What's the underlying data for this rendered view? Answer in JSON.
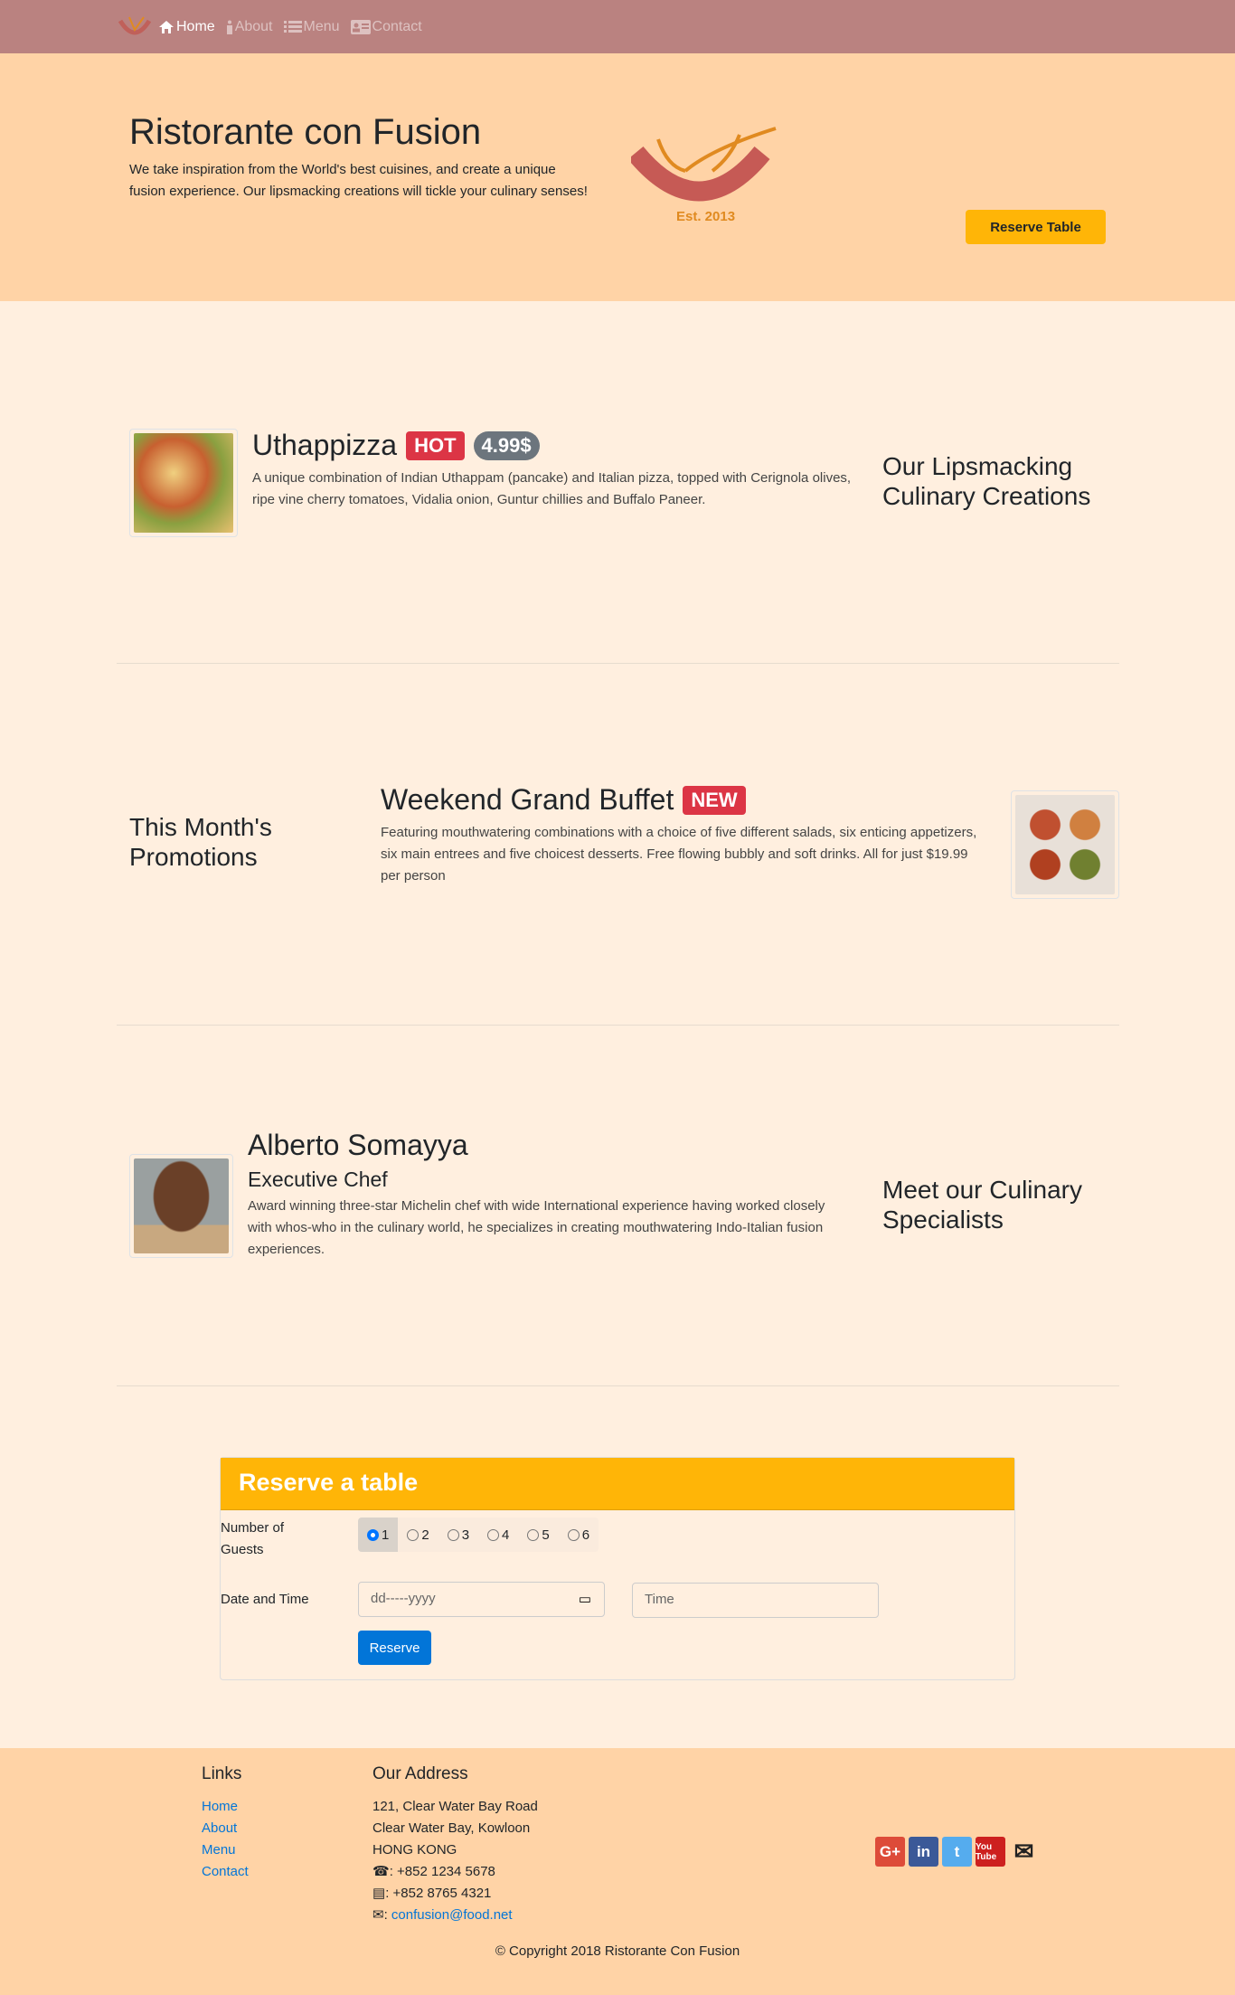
{
  "nav": {
    "items": [
      {
        "label": "Home",
        "icon": "home-icon",
        "active": true
      },
      {
        "label": "About",
        "icon": "info-icon"
      },
      {
        "label": "Menu",
        "icon": "list-icon"
      },
      {
        "label": "Contact",
        "icon": "address-card-icon"
      }
    ]
  },
  "hero": {
    "title": "Ristorante con Fusion",
    "text": "We take inspiration from the World's best cuisines, and create a unique fusion experience. Our lipsmacking creations will tickle your culinary senses!",
    "logo_text": "Ristorante con Fusion",
    "logo_est": "Est. 2013",
    "reserve_label": "Reserve Table"
  },
  "dish": {
    "name": "Uthappizza",
    "badge": "HOT",
    "price": "4.99$",
    "description": "A unique combination of Indian Uthappam (pancake) and Italian pizza, topped with Cerignola olives, ripe vine cherry tomatoes, Vidalia onion, Guntur chillies and Buffalo Paneer.",
    "side_heading": "Our Lipsmacking Culinary Creations"
  },
  "promo": {
    "side_heading": "This Month's Promotions",
    "name": "Weekend Grand Buffet",
    "badge": "NEW",
    "description": "Featuring mouthwatering combinations with a choice of five different salads, six enticing appetizers, six main entrees and five choicest desserts. Free flowing bubbly and soft drinks. All for just $19.99 per person"
  },
  "leader": {
    "name": "Alberto Somayya",
    "designation": "Executive Chef",
    "description": "Award winning three-star Michelin chef with wide International experience having worked closely with whos-who in the culinary world, he specializes in creating mouthwatering Indo-Italian fusion experiences.",
    "side_heading": "Meet our Culinary Specialists"
  },
  "reserve": {
    "title": "Reserve a table",
    "guests_label": "Number of Guests",
    "guests": [
      "1",
      "2",
      "3",
      "4",
      "5",
      "6"
    ],
    "selected": "1",
    "date_label": "Date and Time",
    "date_placeholder": "dd-----yyyy",
    "time_placeholder": "Time",
    "submit": "Reserve"
  },
  "footer": {
    "links_title": "Links",
    "links": [
      "Home",
      "About",
      "Menu",
      "Contact"
    ],
    "address_title": "Our Address",
    "address": [
      "121, Clear Water Bay Road",
      "Clear Water Bay, Kowloon",
      "HONG KONG"
    ],
    "phone": ": +852 1234 5678",
    "fax": ": +852 8765 4321",
    "email": "confusion@food.net",
    "social": [
      "google-plus",
      "linkedin",
      "twitter",
      "youtube",
      "email"
    ],
    "copyright": "© Copyright 2018 Ristorante Con Fusion"
  },
  "colors": {
    "navbar": "#BA8280",
    "jumbotron": "#FFD3A6",
    "body": "#FFEFDF",
    "accent": "#FFB507",
    "hot": "#DC3545",
    "primary": "#0275D8"
  }
}
